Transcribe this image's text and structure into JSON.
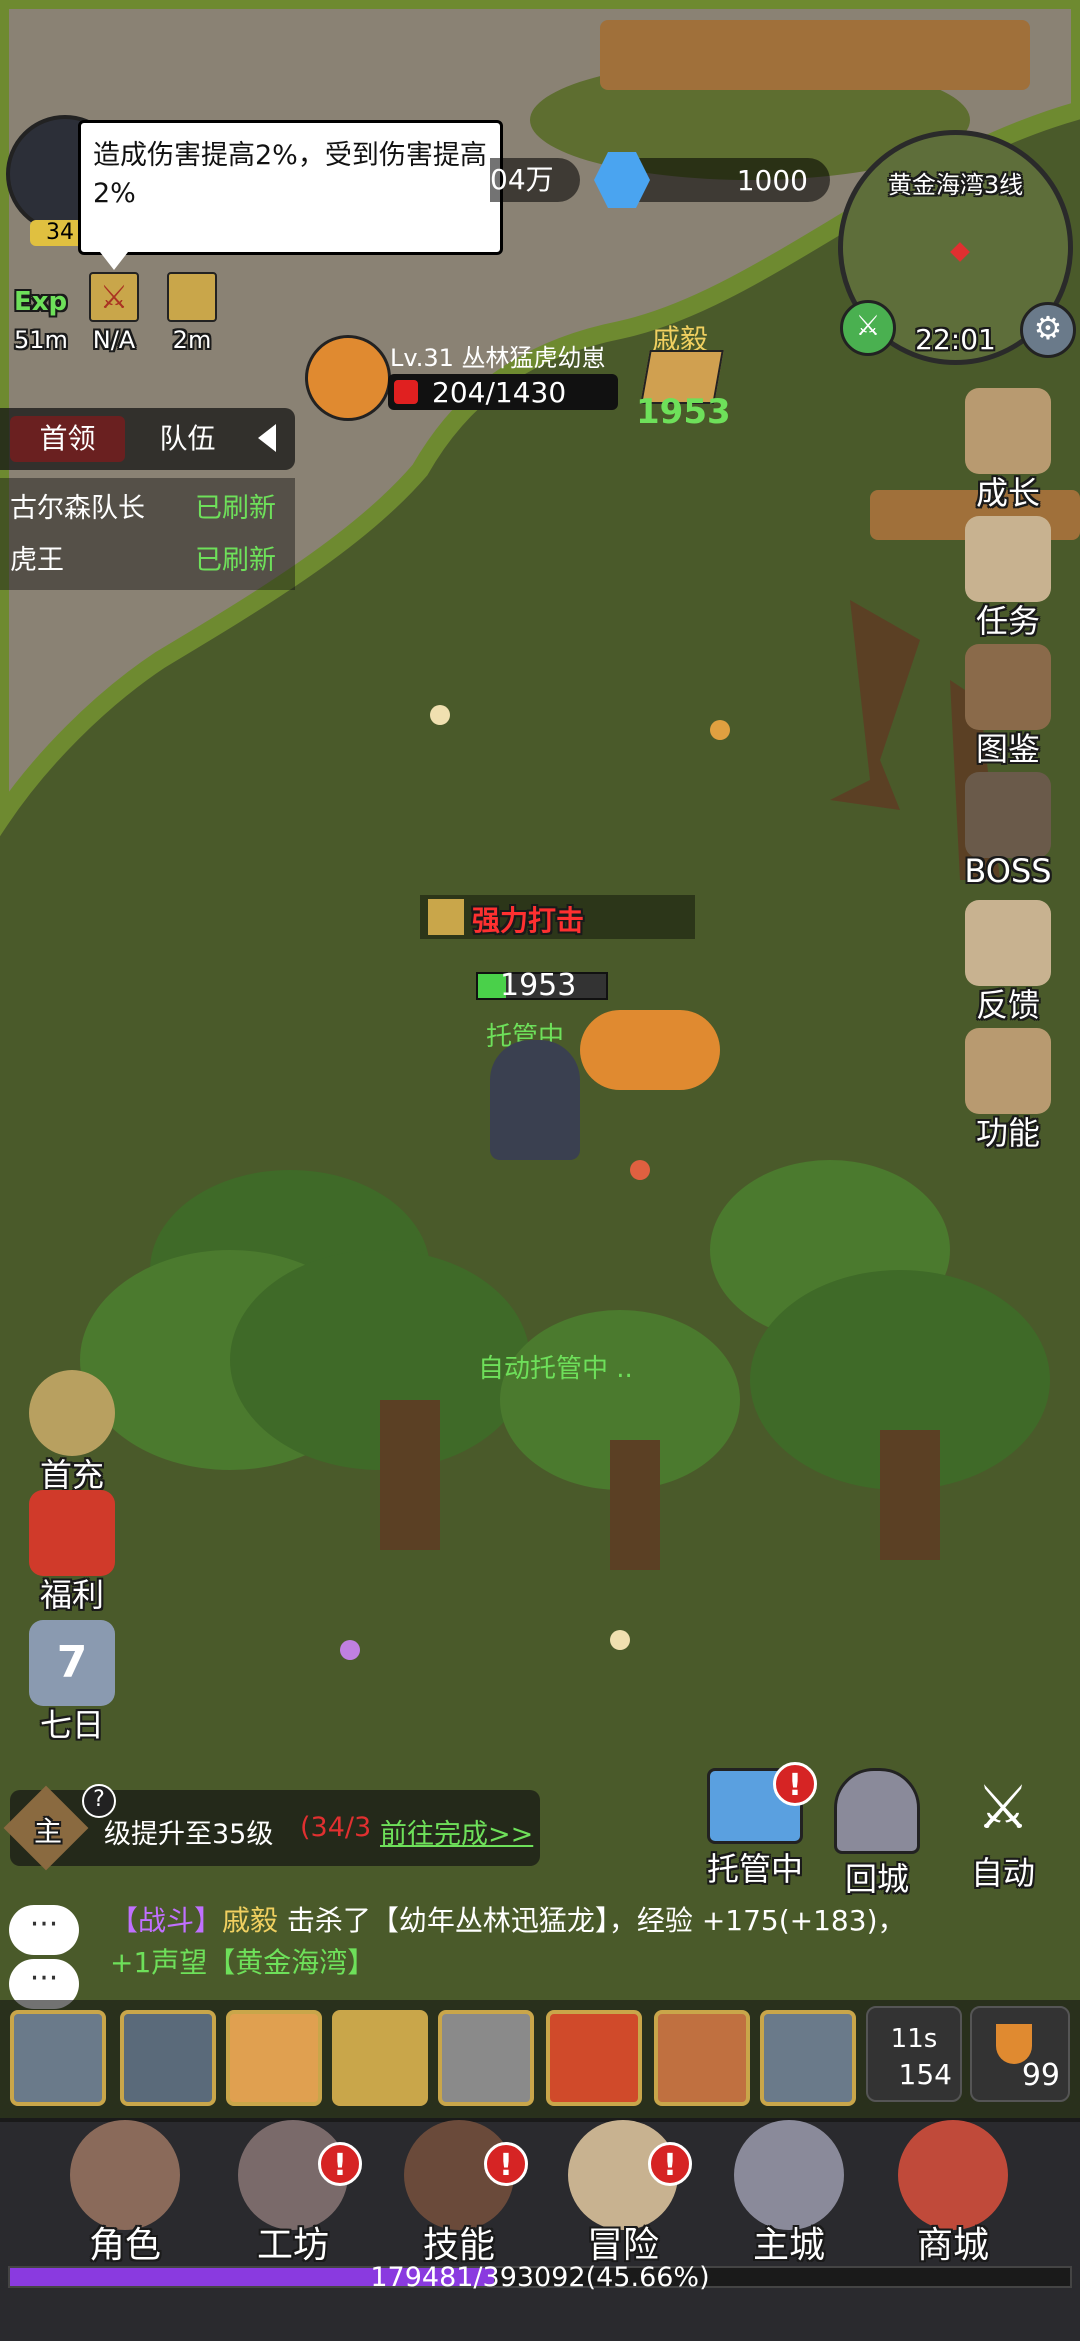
{
  "player": {
    "level_badge": "34",
    "coins_partial": "04万",
    "gems": "1000",
    "tooltip": "造成伤害提高2%，受到伤害提高2%"
  },
  "buffs": [
    {
      "icon": "exp-icon",
      "label": "51m"
    },
    {
      "icon": "crossed-swords-icon",
      "label": "N/A"
    },
    {
      "icon": "shout-icon",
      "label": "2m"
    }
  ],
  "minimap": {
    "title": "黄金海湾3线",
    "time": "22:01"
  },
  "target": {
    "level_name": "Lv.31 丛林猛虎幼崽",
    "hp": "204/1430"
  },
  "ally": {
    "name": "戚毅",
    "power": "1953"
  },
  "boss_panel": {
    "tabs": [
      "首领",
      "队伍"
    ],
    "rows": [
      {
        "name": "古尔森队长",
        "status": "已刷新"
      },
      {
        "name": "虎王",
        "status": "已刷新"
      }
    ]
  },
  "right_menu": [
    "成长",
    "任务",
    "图鉴",
    "BOSS",
    "反馈",
    "功能"
  ],
  "left_menu": [
    "首充",
    "福利",
    "七日"
  ],
  "hero": {
    "skill_text": "强力打击",
    "power": "1953",
    "status": "托管中",
    "auto_text": "自动托管中 .."
  },
  "quest": {
    "prefix": "主",
    "text": "级提升至35级",
    "progress": "(34/3",
    "link": "前往完成>>"
  },
  "quick_actions": [
    "托管中",
    "回城",
    "自动"
  ],
  "chat": {
    "label": "聊天",
    "tag": "【战斗】",
    "name": "戚毅",
    "message": " 击杀了【幼年丛林迅猛龙】，经验 +175(+183)，",
    "message2": "+1声望【黄金海湾】"
  },
  "skills": [
    {
      "icon": "claw-slash-icon"
    },
    {
      "icon": "axe-swing-icon"
    },
    {
      "icon": "whirlwind-icon"
    },
    {
      "icon": "battle-cry-icon"
    },
    {
      "icon": "hammer-strike-icon"
    },
    {
      "icon": "skull-fire-icon"
    },
    {
      "icon": "berserk-icon"
    },
    {
      "icon": "shield-star-icon"
    }
  ],
  "cooldown": {
    "time": "11s",
    "count": "154"
  },
  "potion": {
    "count": "99"
  },
  "bottom_nav": [
    "角色",
    "工坊",
    "技能",
    "冒险",
    "主城",
    "商城"
  ],
  "exp_bar": {
    "text": "179481/393092(45.66%)",
    "percent": 45.66
  },
  "colors": {
    "accent_gold": "#c9a64a",
    "link_green": "#5ee05e",
    "alert_red": "#d62424"
  }
}
